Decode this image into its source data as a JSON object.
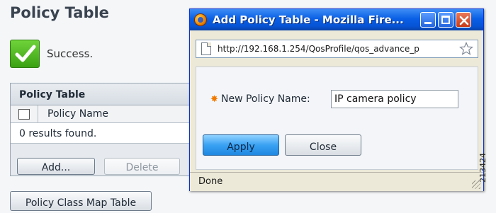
{
  "background": {
    "page_title": "Policy Table",
    "success_text": "Success.",
    "table": {
      "title": "Policy Table",
      "columns": [
        "Policy Name"
      ],
      "results_text": "0 results found."
    },
    "buttons": {
      "add": "Add...",
      "delete": "Delete",
      "class_map": "Policy Class Map Table"
    }
  },
  "popup": {
    "title": "Add Policy Table - Mozilla Fire...",
    "url": "http://192.168.1.254/QosProfile/qos_advance_p",
    "form": {
      "label": "New Policy Name:",
      "value": "IP camera policy"
    },
    "buttons": {
      "apply": "Apply",
      "close": "Close"
    },
    "status": "Done"
  },
  "side_id": "213424",
  "colors": {
    "titlebar": "#0a5fe5",
    "apply_button": "#3aa2f3",
    "success": "#3aa112",
    "required_marker": "#f07a00"
  },
  "icons": {
    "success": "checkmark-icon",
    "browser": "firefox-icon",
    "page": "page-icon",
    "bookmark": "star-icon"
  }
}
